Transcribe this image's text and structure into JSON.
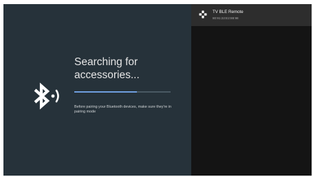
{
  "pairing": {
    "icon": "bluetooth-searching-icon",
    "title_line1": "Searching for",
    "title_line2": "accessories...",
    "progress": 0.65,
    "hint": "Before pairing your Bluetooth devices, make sure they're in pairing mode"
  },
  "devices": [
    {
      "icon": "gamepad-dpad-icon",
      "name": "TV BLE Remote",
      "address": "80:91:22:E2:88:98"
    }
  ],
  "colors": {
    "left_pane_bg": "#26323a",
    "right_pane_bg": "#141414",
    "selected_row_bg": "#2d2d2d",
    "progress_fill": "#6f9fe0",
    "progress_track": "#4a5963"
  }
}
